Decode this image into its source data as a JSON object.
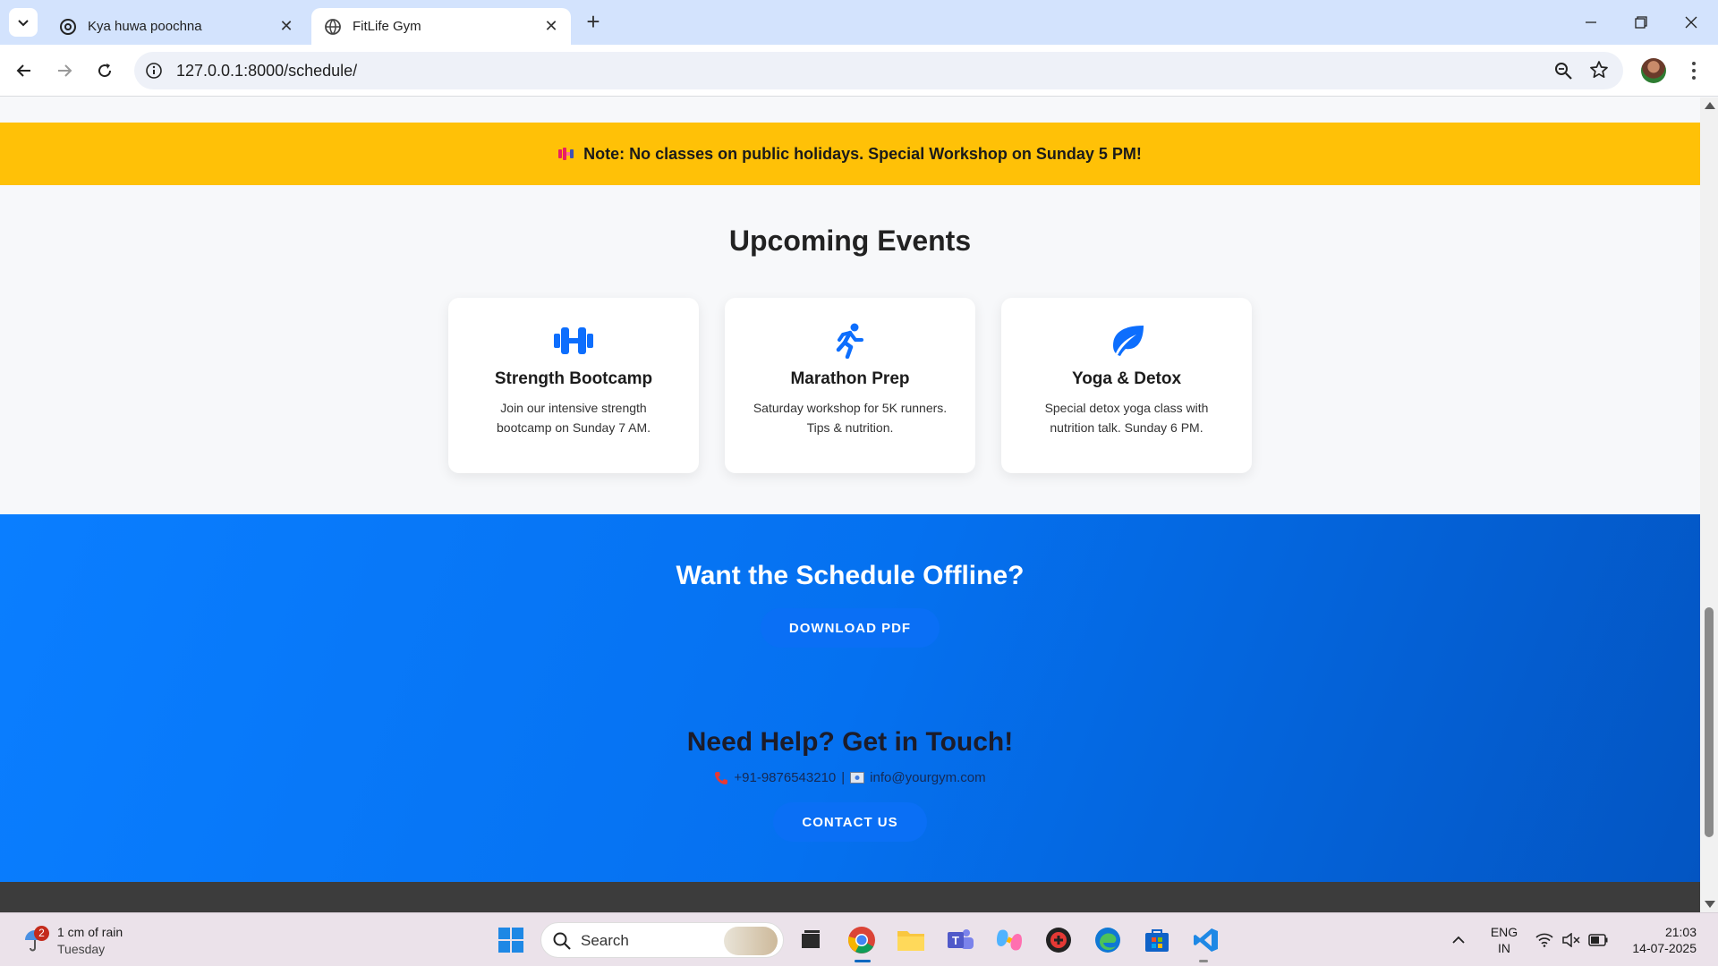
{
  "browser": {
    "tabs": [
      {
        "title": "Kya huwa poochna",
        "active": false
      },
      {
        "title": "FitLife Gym",
        "active": true
      }
    ],
    "url": "127.0.0.1:8000/schedule/"
  },
  "page": {
    "notice": "Note: No classes on public holidays. Special Workshop on Sunday 5 PM!",
    "events_title": "Upcoming Events",
    "events": [
      {
        "icon": "dumbbell-icon",
        "title": "Strength Bootcamp",
        "description": "Join our intensive strength bootcamp on Sunday 7 AM."
      },
      {
        "icon": "running-icon",
        "title": "Marathon Prep",
        "description": "Saturday workshop for 5K runners. Tips & nutrition."
      },
      {
        "icon": "leaf-icon",
        "title": "Yoga & Detox",
        "description": "Special detox yoga class with nutrition talk. Sunday 6 PM."
      }
    ],
    "offline": {
      "title": "Want the Schedule Offline?",
      "button": "DOWNLOAD PDF"
    },
    "help": {
      "title": "Need Help? Get in Touch!",
      "phone": "+91-9876543210",
      "separator": "|",
      "email": "info@yourgym.com",
      "button": "CONTACT US"
    }
  },
  "taskbar": {
    "weather": {
      "badge": "2",
      "line1": "1 cm of rain",
      "line2": "Tuesday"
    },
    "search_placeholder": "Search",
    "language": {
      "line1": "ENG",
      "line2": "IN"
    },
    "clock": {
      "time": "21:03",
      "date": "14-07-2025"
    }
  },
  "colors": {
    "notice_bg": "#ffc107",
    "accent_blue": "#0a6ff5",
    "icon_blue": "#0d6efd",
    "footer": "#3c3c3c"
  }
}
